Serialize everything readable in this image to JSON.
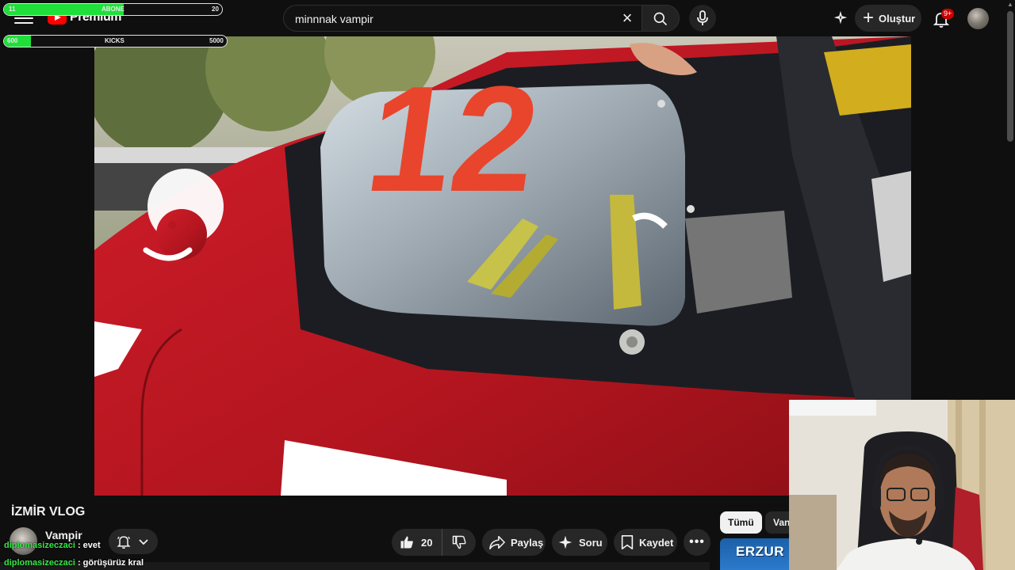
{
  "header": {
    "logo_text": "Premium",
    "search_value": "minnnak vampir",
    "create_label": "Oluştur",
    "notification_badge": "9+"
  },
  "overlay": {
    "abone": {
      "label": "ABONE",
      "left": "11",
      "right": "20",
      "progress": 0.55
    },
    "kicks": {
      "label": "KICKS",
      "left": "600",
      "right": "5000",
      "progress": 0.12
    }
  },
  "video": {
    "title": "İZMİR VLOG",
    "channel_name": "Vampir"
  },
  "actions": {
    "like_count": "20",
    "share_label": "Paylaş",
    "ask_label": "Soru",
    "save_label": "Kaydet"
  },
  "chips": {
    "all_label": "Tümü",
    "second_label": "Van"
  },
  "recommendation": {
    "thumb_text": "ERZUR"
  },
  "chat": [
    {
      "user": "diplomasizeczaci",
      "message": ": evet"
    },
    {
      "user": "diplomasizeczaci",
      "message": ": görüşürüz kral"
    }
  ],
  "icons": {
    "menu": "menu-icon",
    "search": "search-icon",
    "mic": "mic-icon",
    "clear": "close-icon",
    "bell": "bell-icon",
    "like": "thumbs-up-icon",
    "dislike": "thumbs-down-icon",
    "share": "share-arrow-icon",
    "ask": "sparkle-icon",
    "save": "bookmark-icon"
  },
  "colors": {
    "accent": "#ff0000",
    "progress": "#1fe03a",
    "chat_user": "#33e844"
  }
}
